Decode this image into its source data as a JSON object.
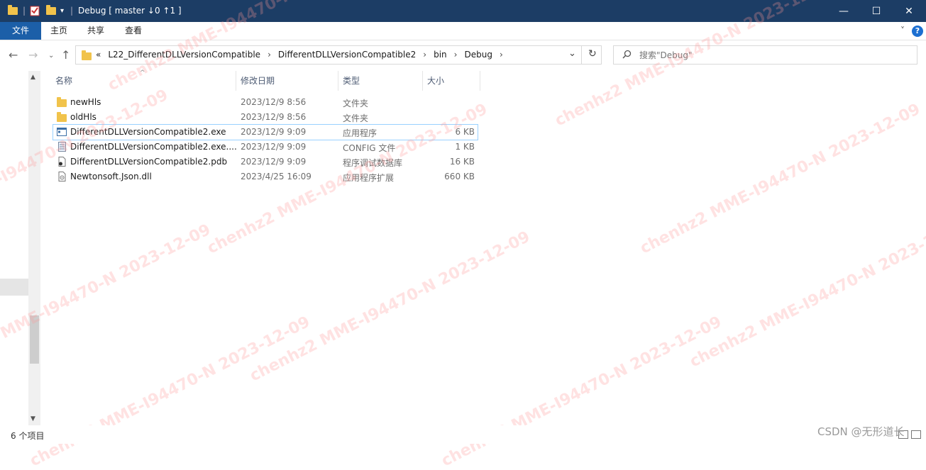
{
  "window": {
    "title": "Debug [ master ↓0 ↑1 ]",
    "minimize": "—",
    "maximize": "☐",
    "close": "✕"
  },
  "ribbon": {
    "tabs": [
      "文件",
      "主页",
      "共享",
      "查看"
    ],
    "collapse": "˅",
    "help": "?"
  },
  "address": {
    "overflow": "«",
    "crumbs": [
      "L22_DifferentDLLVersionCompatible",
      "DifferentDLLVersionCompatible2",
      "bin",
      "Debug"
    ],
    "separator": "›",
    "dropdown": "⌄",
    "refresh": "↻"
  },
  "search": {
    "placeholder": "搜索\"Debug\""
  },
  "columns": {
    "name": "名称",
    "date": "修改日期",
    "type": "类型",
    "size": "大小"
  },
  "files": [
    {
      "name": "newHls",
      "date": "2023/12/9 8:56",
      "type": "文件夹",
      "size": "",
      "icon": "folder-icon"
    },
    {
      "name": "oldHls",
      "date": "2023/12/9 8:56",
      "type": "文件夹",
      "size": "",
      "icon": "folder-icon"
    },
    {
      "name": "DifferentDLLVersionCompatible2.exe",
      "date": "2023/12/9 9:09",
      "type": "应用程序",
      "size": "6 KB",
      "icon": "exe-icon"
    },
    {
      "name": "DifferentDLLVersionCompatible2.exe....",
      "date": "2023/12/9 9:09",
      "type": "CONFIG 文件",
      "size": "1 KB",
      "icon": "config-icon"
    },
    {
      "name": "DifferentDLLVersionCompatible2.pdb",
      "date": "2023/12/9 9:09",
      "type": "程序调试数据库",
      "size": "16 KB",
      "icon": "pdb-icon"
    },
    {
      "name": "Newtonsoft.Json.dll",
      "date": "2023/4/25 16:09",
      "type": "应用程序扩展",
      "size": "660 KB",
      "icon": "dll-icon"
    }
  ],
  "status": {
    "count": "6 个项目"
  },
  "watermark": {
    "text": "chenhz2  MME-I94470-N  2023-12-09",
    "csdn": "CSDN @无形道长"
  },
  "colors": {
    "titlebar": "#1c3d65",
    "file_tab": "#1c5fa8",
    "folder": "#f1c34b",
    "selection": "#99d1ff"
  }
}
